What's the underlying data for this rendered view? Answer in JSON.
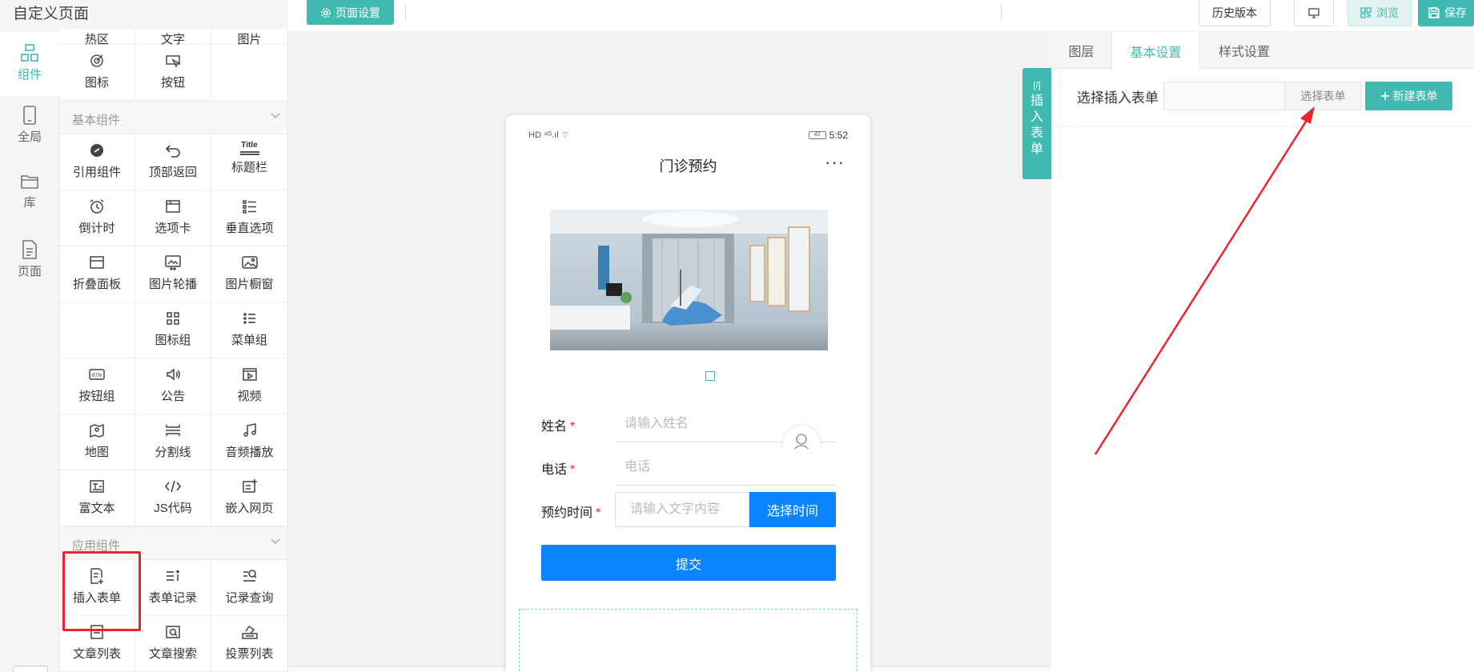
{
  "app_title": "自定义页面",
  "rail": [
    {
      "label": "组件",
      "icon": "components-icon",
      "active": true
    },
    {
      "label": "全局",
      "icon": "phone-icon"
    },
    {
      "label": "库",
      "icon": "folder-icon"
    },
    {
      "label": "页面",
      "icon": "page-icon"
    }
  ],
  "panel": {
    "top_cells": [
      "热区",
      "文字",
      "图片"
    ],
    "basic_top_cells": [
      "图标",
      "按钮"
    ],
    "basic_section": "基本组件",
    "basic_cells": [
      "引用组件",
      "顶部返回",
      "标题栏",
      "倒计时",
      "选项卡",
      "垂直选项",
      "折叠面板",
      "图片轮播",
      "图片橱窗",
      "图标组",
      "菜单组",
      "按钮组",
      "公告",
      "视频",
      "地图",
      "分割线",
      "音频播放",
      "富文本",
      "JS代码",
      "嵌入网页"
    ],
    "app_section": "应用组件",
    "app_cells": [
      "插入表单",
      "表单记录",
      "记录查询",
      "文章列表",
      "文章搜索",
      "投票列表"
    ],
    "title_icon_text": "Title"
  },
  "topbar": {
    "page_settings": "页面设置",
    "history": "历史版本",
    "preview": "浏览",
    "save": "保存"
  },
  "phone": {
    "title": "门诊预约",
    "status_left": "HD ⁴ᴳ.ıl ⌔",
    "battery": "42",
    "time": "5:52",
    "fields": {
      "name_label": "姓名",
      "name_placeholder": "请输入姓名",
      "phone_label": "电话",
      "phone_placeholder": "电话",
      "time_label": "预约时间",
      "time_placeholder": "请输入文字内容",
      "time_button": "选择时间",
      "required_mark": "*"
    },
    "submit": "提交"
  },
  "side_tab": {
    "code": "[/]",
    "text": "插入表单"
  },
  "right_panel": {
    "tabs": [
      "图层",
      "基本设置",
      "样式设置"
    ],
    "active_tab": 1,
    "select_form_label": "选择插入表单",
    "select_form_button": "选择表单",
    "new_form_button": "新建表单"
  },
  "colors": {
    "accent": "#40b9b1",
    "primary_blue": "#0a84ff",
    "highlight_red": "#e8262b"
  }
}
